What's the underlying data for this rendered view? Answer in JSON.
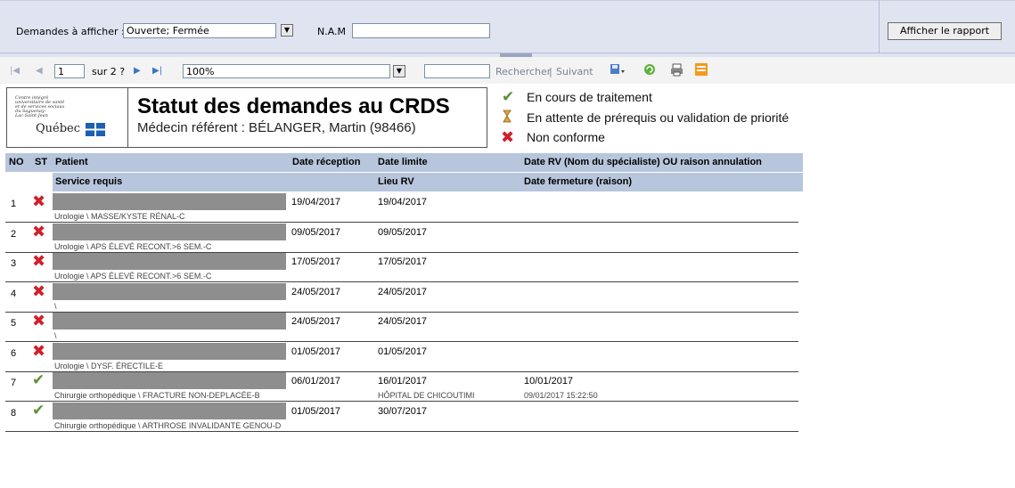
{
  "params": {
    "requests_label": "Demandes à afficher :",
    "requests_value": "Ouverte; Fermée",
    "nam_label": "N.A.M",
    "nam_value": "",
    "view_report_button": "Afficher le rapport"
  },
  "toolbar": {
    "page_value": "1",
    "page_of": "sur 2 ?",
    "zoom_value": "100%",
    "search_value": "",
    "search_link": "Rechercher",
    "separator": "|",
    "next_link": "Suivant"
  },
  "header": {
    "logo_lines": [
      "Centre intégré",
      "universitaire de santé",
      "et de services sociaux",
      "du Saguenay–",
      "Lac-Saint-Jean"
    ],
    "logo_quebec": "Québec",
    "title": "Statut des demandes au CRDS",
    "subtitle": "Médecin référent : BÉLANGER, Martin (98466)"
  },
  "legend": [
    {
      "icon": "check-icon",
      "text": "En cours de traitement"
    },
    {
      "icon": "hourglass-icon",
      "text": "En attente de prérequis ou validation de priorité"
    },
    {
      "icon": "cross-icon",
      "text": "Non conforme"
    }
  ],
  "columns": {
    "no": "NO",
    "st": "ST",
    "patient": "Patient",
    "received": "Date réception",
    "deadline": "Date limite",
    "appointment": "Date RV (Nom du spécialiste) OU raison annulation",
    "service": "Service requis",
    "location": "Lieu RV",
    "closed": "Date fermeture (raison)"
  },
  "rows": [
    {
      "no": "1",
      "status": "cross",
      "received": "19/04/2017",
      "deadline": "19/04/2017",
      "appointment": "",
      "service": "Urologie \\ MASSE/KYSTE RÉNAL-C",
      "location": "",
      "closed": ""
    },
    {
      "no": "2",
      "status": "cross",
      "received": "09/05/2017",
      "deadline": "09/05/2017",
      "appointment": "",
      "service": "Urologie \\ APS ÉLEVÉ RECONT.>6 SEM.-C",
      "location": "",
      "closed": ""
    },
    {
      "no": "3",
      "status": "cross",
      "received": "17/05/2017",
      "deadline": "17/05/2017",
      "appointment": "",
      "service": "Urologie \\ APS ÉLEVÉ RECONT.>6 SEM.-C",
      "location": "",
      "closed": ""
    },
    {
      "no": "4",
      "status": "cross",
      "received": "24/05/2017",
      "deadline": "24/05/2017",
      "appointment": "",
      "service": "\\",
      "location": "",
      "closed": ""
    },
    {
      "no": "5",
      "status": "cross",
      "received": "24/05/2017",
      "deadline": "24/05/2017",
      "appointment": "",
      "service": "\\",
      "location": "",
      "closed": ""
    },
    {
      "no": "6",
      "status": "cross",
      "received": "01/05/2017",
      "deadline": "01/05/2017",
      "appointment": "",
      "service": "Urologie \\ DYSF. ÉRECTILE-E",
      "location": "",
      "closed": ""
    },
    {
      "no": "7",
      "status": "check",
      "received": "06/01/2017",
      "deadline": "16/01/2017",
      "appointment": "10/01/2017",
      "service": "Chirurgie orthopédique \\ FRACTURE NON-DEPLACÉE-B",
      "location": "HÔPITAL DE CHICOUTIMI",
      "closed": "09/01/2017 15:22:50"
    },
    {
      "no": "8",
      "status": "check",
      "received": "01/05/2017",
      "deadline": "30/07/2017",
      "appointment": "",
      "service": "Chirurgie orthopédique \\ ARTHROSE INVALIDANTE GENOU-D",
      "location": "",
      "closed": ""
    }
  ]
}
